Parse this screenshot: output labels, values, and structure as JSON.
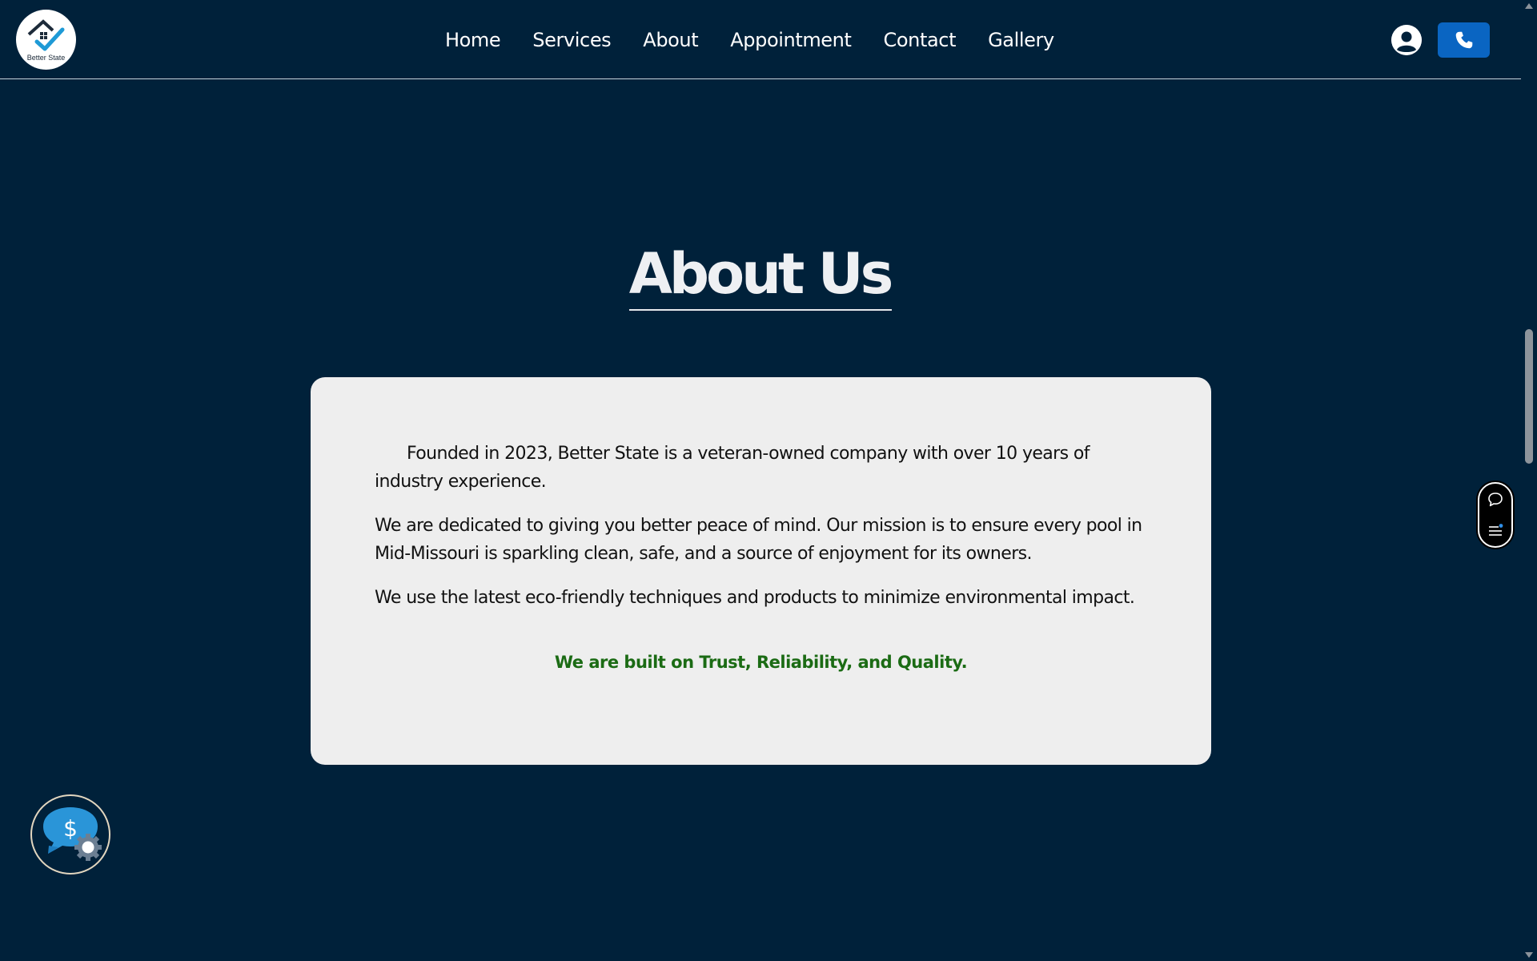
{
  "header": {
    "logo_text": "Better State",
    "nav": [
      {
        "label": "Home"
      },
      {
        "label": "Services"
      },
      {
        "label": "About"
      },
      {
        "label": "Appointment"
      },
      {
        "label": "Contact"
      },
      {
        "label": "Gallery"
      }
    ],
    "icons": {
      "account": "user-circle-icon",
      "phone": "phone-icon"
    }
  },
  "about": {
    "title": "About Us",
    "paragraphs": [
      "Founded in 2023, Better State is a veteran-owned company with over 10 years of industry experience.",
      "We are dedicated to giving you better peace of mind. Our mission is to ensure every pool in Mid-Missouri is sparkling clean, safe, and a source of enjoyment for its owners.",
      "We use the latest eco-friendly techniques and products to minimize environmental impact."
    ],
    "tagline": "We are built on Trust, Reliability, and Quality."
  },
  "widgets": {
    "side": [
      "chat-bubble-icon",
      "menu-icon"
    ],
    "quote": "dollar-chat-icon"
  },
  "colors": {
    "background": "#00213a",
    "card": "#eeeeee",
    "accent_blue": "#0a65c2",
    "tagline_green": "#1b6b14"
  }
}
